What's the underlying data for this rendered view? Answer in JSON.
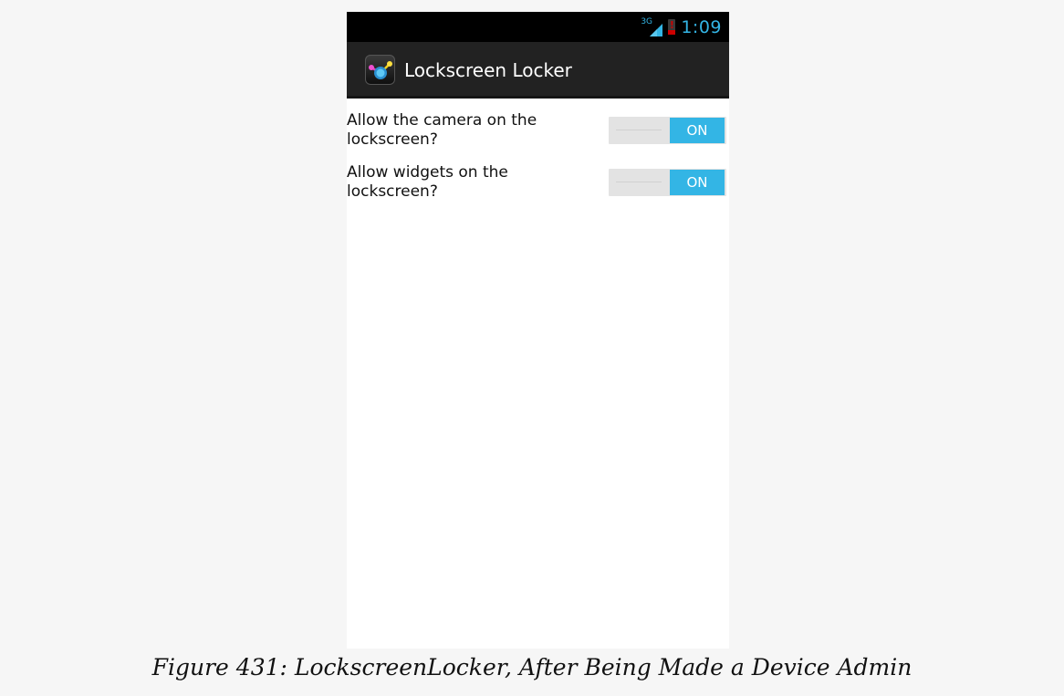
{
  "status_bar": {
    "network_type": "3G",
    "battery_alert": "!",
    "time": "1:09"
  },
  "action_bar": {
    "app_icon": "lockscreen-locker-app-icon",
    "title": "Lockscreen Locker"
  },
  "settings": [
    {
      "label": "Allow the camera on the lockscreen?",
      "toggle_label": "ON",
      "checked": true
    },
    {
      "label": "Allow widgets on the lockscreen?",
      "toggle_label": "ON",
      "checked": true
    }
  ],
  "colors": {
    "accent": "#33b5e5",
    "action_bar": "#222222",
    "status_bar": "#000000",
    "background": "#ffffff"
  },
  "caption": "Figure 431: LockscreenLocker, After Being Made a Device Admin"
}
